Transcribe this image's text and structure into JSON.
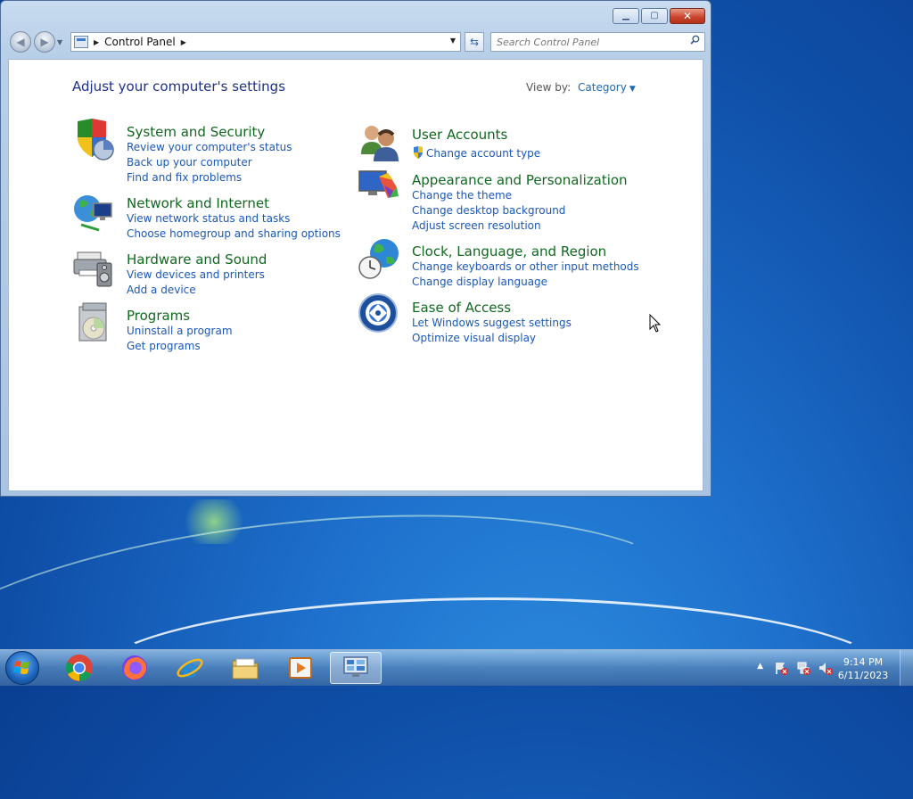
{
  "window": {
    "address": {
      "location": "Control Panel"
    },
    "search": {
      "placeholder": "Search Control Panel"
    },
    "content": {
      "heading": "Adjust your computer's settings",
      "view_by_label": "View by:",
      "view_by_value": "Category",
      "categories": [
        {
          "title": "System and Security",
          "icon": "system-security-icon",
          "links": [
            "Review your computer's status",
            "Back up your computer",
            "Find and fix problems"
          ]
        },
        {
          "title": "Network and Internet",
          "icon": "network-internet-icon",
          "links": [
            "View network status and tasks",
            "Choose homegroup and sharing options"
          ]
        },
        {
          "title": "Hardware and Sound",
          "icon": "hardware-sound-icon",
          "links": [
            "View devices and printers",
            "Add a device"
          ]
        },
        {
          "title": "Programs",
          "icon": "programs-icon",
          "links": [
            "Uninstall a program",
            "Get programs"
          ]
        },
        {
          "title": "User Accounts",
          "icon": "user-accounts-icon",
          "links": [
            "Change account type"
          ]
        },
        {
          "title": "Appearance and Personalization",
          "icon": "appearance-icon",
          "links": [
            "Change the theme",
            "Change desktop background",
            "Adjust screen resolution"
          ]
        },
        {
          "title": "Clock, Language, and Region",
          "icon": "clock-language-icon",
          "links": [
            "Change keyboards or other input methods",
            "Change display language"
          ]
        },
        {
          "title": "Ease of Access",
          "icon": "ease-of-access-icon",
          "links": [
            "Let Windows suggest settings",
            "Optimize visual display"
          ]
        }
      ]
    }
  },
  "taskbar": {
    "apps": [
      "chrome-icon",
      "firefox-icon",
      "internet-explorer-icon",
      "file-explorer-icon",
      "media-player-icon",
      "control-panel-icon"
    ],
    "clock": {
      "time": "9:14 PM",
      "date": "6/11/2023"
    }
  }
}
